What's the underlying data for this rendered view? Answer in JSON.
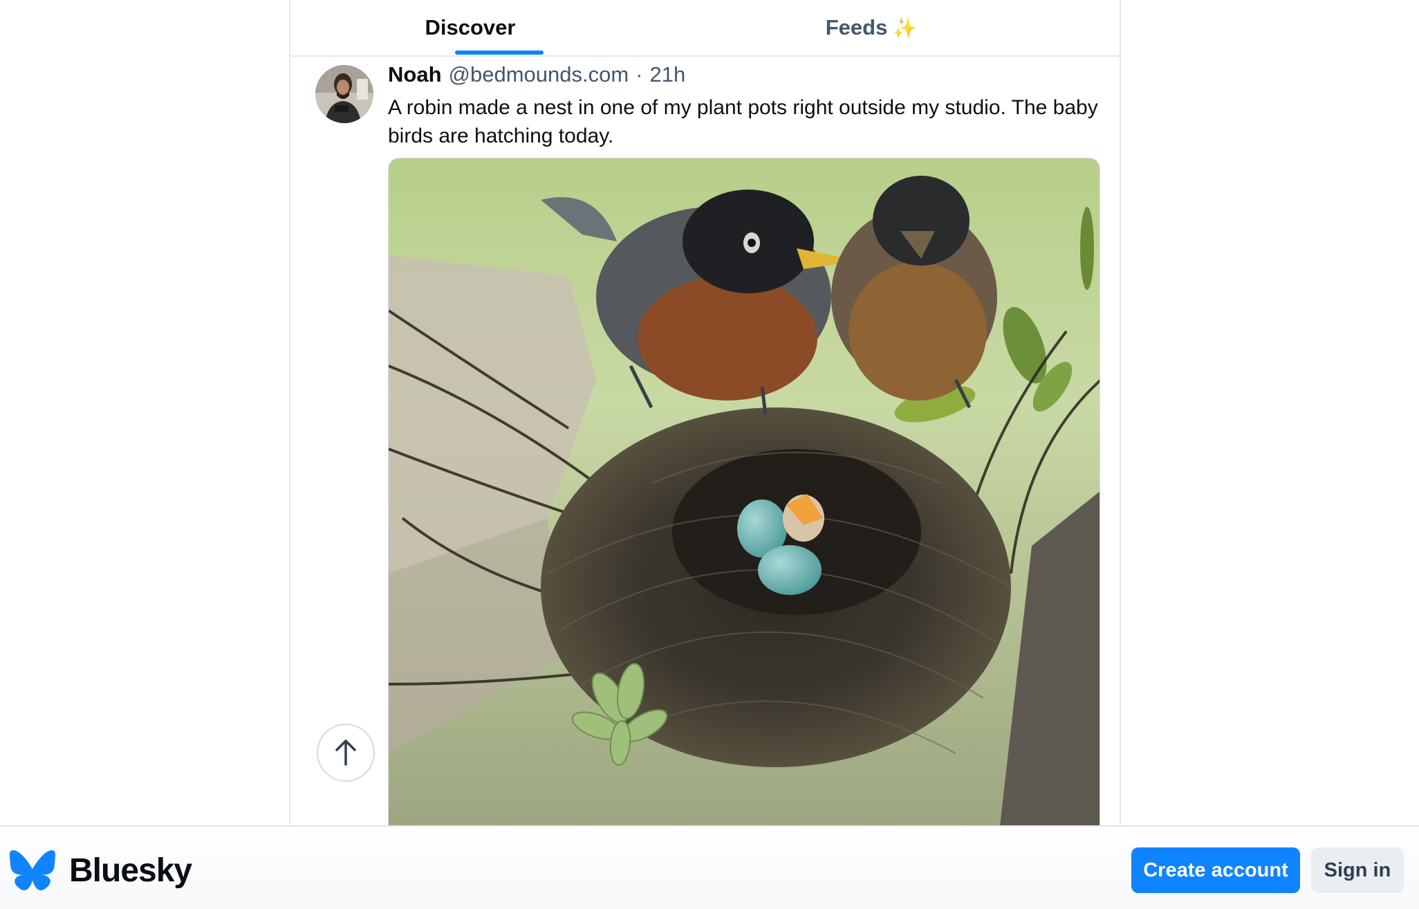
{
  "tabs": [
    {
      "label": "Discover",
      "active": true
    },
    {
      "label": "Feeds",
      "suffix": "✨",
      "active": false
    }
  ],
  "post": {
    "author_name": "Noah",
    "author_handle": "@bedmounds.com",
    "separator": "·",
    "time": "21h",
    "text": "A robin made a nest in one of my plant pots right outside my studio. The baby birds are hatching today."
  },
  "icons": {
    "scroll_top": "arrow-up-icon",
    "brand": "butterfly-icon"
  },
  "footer": {
    "brand_name": "Bluesky",
    "create_account_label": "Create account",
    "sign_in_label": "Sign in"
  },
  "colors": {
    "accent": "#1083fe",
    "text_primary": "#0b0f14",
    "text_secondary": "#42576c",
    "border": "#e3e7ec"
  }
}
